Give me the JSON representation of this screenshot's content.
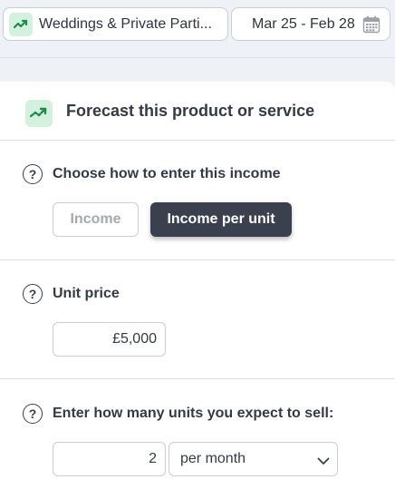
{
  "topbar": {
    "product_label": "Weddings & Private Parti...",
    "product_icon": "trend-icon",
    "date_range": "Mar 25 - Feb 28",
    "date_icon": "calendar-icon"
  },
  "card": {
    "title": "Forecast this product or service",
    "title_icon": "trend-icon"
  },
  "sections": {
    "entry_method": {
      "question": "Choose how to enter this income",
      "options": [
        "Income",
        "Income per unit"
      ],
      "selected": "Income per unit"
    },
    "unit_price": {
      "question": "Unit price",
      "value": "£5,000"
    },
    "units": {
      "question": "Enter how many units you expect to sell:",
      "quantity": "2",
      "period": "per month"
    }
  },
  "help_icon_glyph": "?",
  "colors": {
    "accent_green": "#1f8a4c",
    "icon_background": "#d4f0de",
    "selected_button": "#3a404d",
    "page_background": "#eef1f5"
  }
}
